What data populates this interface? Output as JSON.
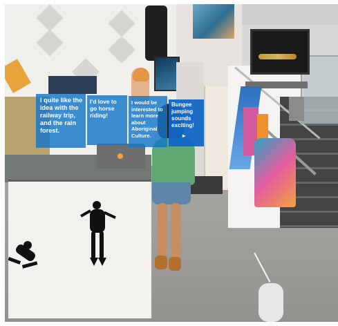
{
  "options": [
    {
      "label": "I quite like the idea with the railway trip, and the rain forest."
    },
    {
      "label": "I'd love to go horse riding!"
    },
    {
      "label": "I would be interested to learn more about Aboriginal Culture."
    },
    {
      "label": "Bungee jumping sounds exciting!"
    }
  ],
  "colors": {
    "chip": "#1476C9",
    "chip_selected": "#1266C4",
    "counter": "#F3F1EE",
    "floor": "#9C9B97"
  },
  "icons": {
    "caret": "triangle-icon"
  }
}
